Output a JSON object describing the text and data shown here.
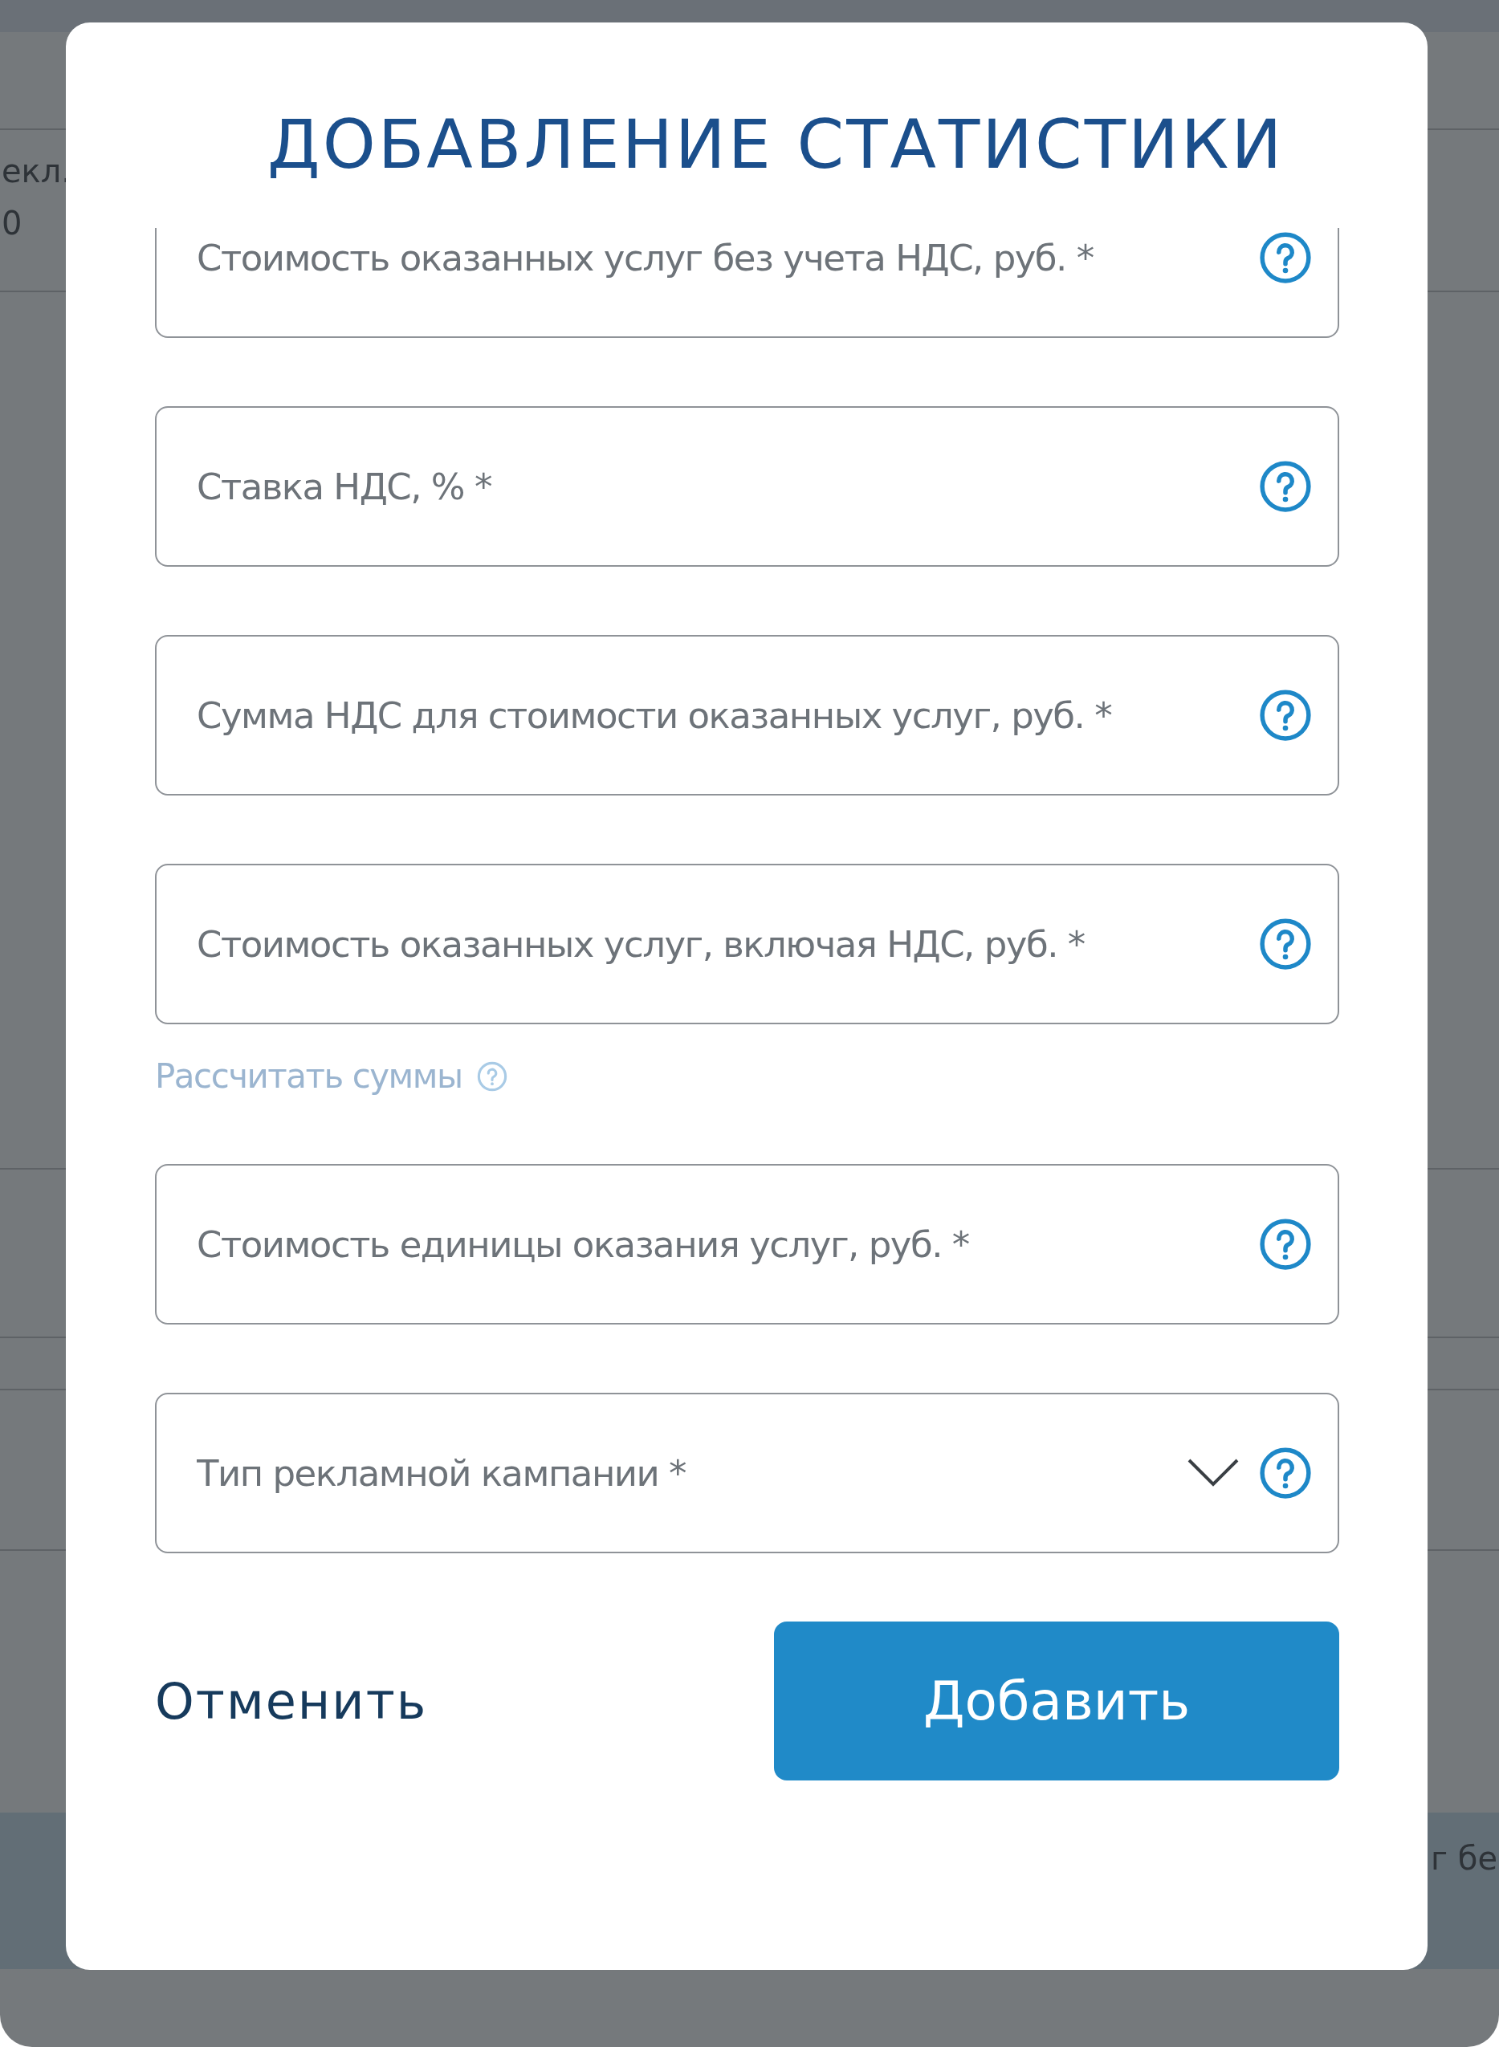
{
  "backdrop": {
    "left_texts": [
      "екл.",
      "0"
    ],
    "right_text": "г бе"
  },
  "dialog": {
    "title": "ДОБАВЛЕНИЕ СТАТИСТИКИ",
    "fields": [
      {
        "kind": "input",
        "placeholder": "Стоимость оказанных услуг без учета НДС, руб. *"
      },
      {
        "kind": "input",
        "placeholder": "Ставка НДС, % *"
      },
      {
        "kind": "input",
        "placeholder": "Сумма НДС для стоимости оказанных услуг, руб. *"
      },
      {
        "kind": "input",
        "placeholder": "Стоимость оказанных услуг, включая НДС, руб. *"
      },
      {
        "kind": "link",
        "label": "Рассчитать суммы"
      },
      {
        "kind": "input",
        "placeholder": "Стоимость единицы оказания услуг, руб. *"
      },
      {
        "kind": "select",
        "placeholder": "Тип рекламной кампании *"
      }
    ],
    "cancel": "Отменить",
    "submit": "Добавить"
  }
}
